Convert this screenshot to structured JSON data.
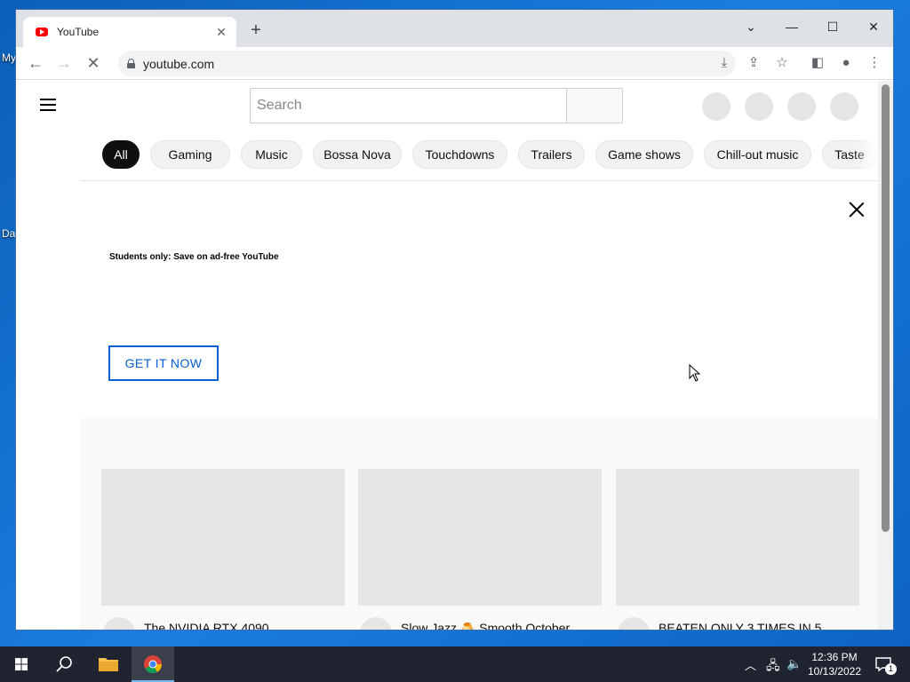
{
  "desktop": {
    "icon_labels": [
      "My",
      "Da"
    ]
  },
  "browser": {
    "tab_title": "YouTube",
    "url": "youtube.com"
  },
  "youtube": {
    "search_placeholder": "Search",
    "chips": [
      {
        "label": "All",
        "active": true
      },
      {
        "label": "Gaming"
      },
      {
        "label": "Music"
      },
      {
        "label": "Bossa Nova"
      },
      {
        "label": "Touchdowns"
      },
      {
        "label": "Trailers"
      },
      {
        "label": "Game shows"
      },
      {
        "label": "Chill-out music"
      },
      {
        "label": "Taste"
      }
    ],
    "banner": {
      "text": "Students only: Save on ad-free YouTube",
      "cta": "GET IT NOW"
    },
    "videos": [
      {
        "title": "The NVIDIA RTX 4090"
      },
      {
        "title": "Slow Jazz 🍮 Smooth October"
      },
      {
        "title": "BEATEN ONLY 3 TIMES IN 5"
      }
    ]
  },
  "taskbar": {
    "time": "12:36 PM",
    "date": "10/13/2022",
    "notification_count": "1"
  },
  "colors": {
    "accent_blue": "#065fd4",
    "taskbar_bg": "#1f2430",
    "desktop_bg": "#1565c0"
  }
}
